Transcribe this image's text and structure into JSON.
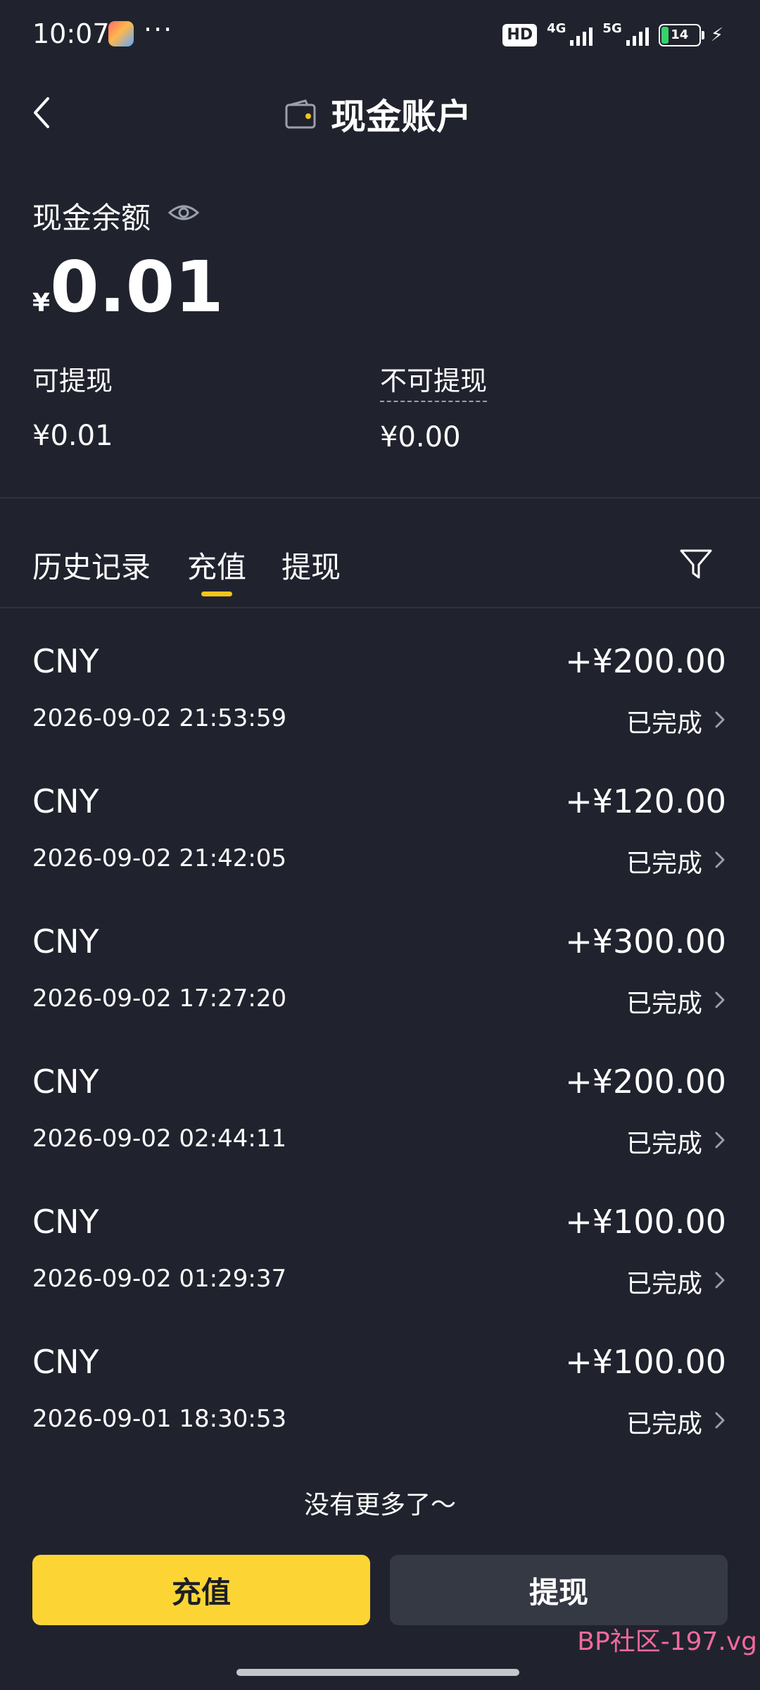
{
  "status_bar": {
    "time": "10:07",
    "dots": "···",
    "hd": "HD",
    "net1": "4G",
    "net2": "5G",
    "battery": "14"
  },
  "header": {
    "title": "现金账户"
  },
  "balance": {
    "label": "现金余额",
    "currency_symbol": "¥",
    "amount": "0.01",
    "withdrawable_label": "可提现",
    "withdrawable_value": "¥0.01",
    "non_withdrawable_label": "不可提现",
    "non_withdrawable_value": "¥0.00"
  },
  "tabs": [
    {
      "label": "历史记录"
    },
    {
      "label": "充值",
      "active": true
    },
    {
      "label": "提现"
    }
  ],
  "records": [
    {
      "currency": "CNY",
      "amount": "+¥200.00",
      "time": "2026-09-02 21:53:59",
      "status": "已完成"
    },
    {
      "currency": "CNY",
      "amount": "+¥120.00",
      "time": "2026-09-02 21:42:05",
      "status": "已完成"
    },
    {
      "currency": "CNY",
      "amount": "+¥300.00",
      "time": "2026-09-02 17:27:20",
      "status": "已完成"
    },
    {
      "currency": "CNY",
      "amount": "+¥200.00",
      "time": "2026-09-02 02:44:11",
      "status": "已完成"
    },
    {
      "currency": "CNY",
      "amount": "+¥100.00",
      "time": "2026-09-02 01:29:37",
      "status": "已完成"
    },
    {
      "currency": "CNY",
      "amount": "+¥100.00",
      "time": "2026-09-01 18:30:53",
      "status": "已完成"
    }
  ],
  "no_more": "没有更多了～",
  "buttons": {
    "recharge": "充值",
    "withdraw": "提现"
  },
  "watermark": "BP社区-197.vg",
  "colors": {
    "background": "#20232d",
    "accent": "#fcd535",
    "secondary_button": "#353944"
  }
}
